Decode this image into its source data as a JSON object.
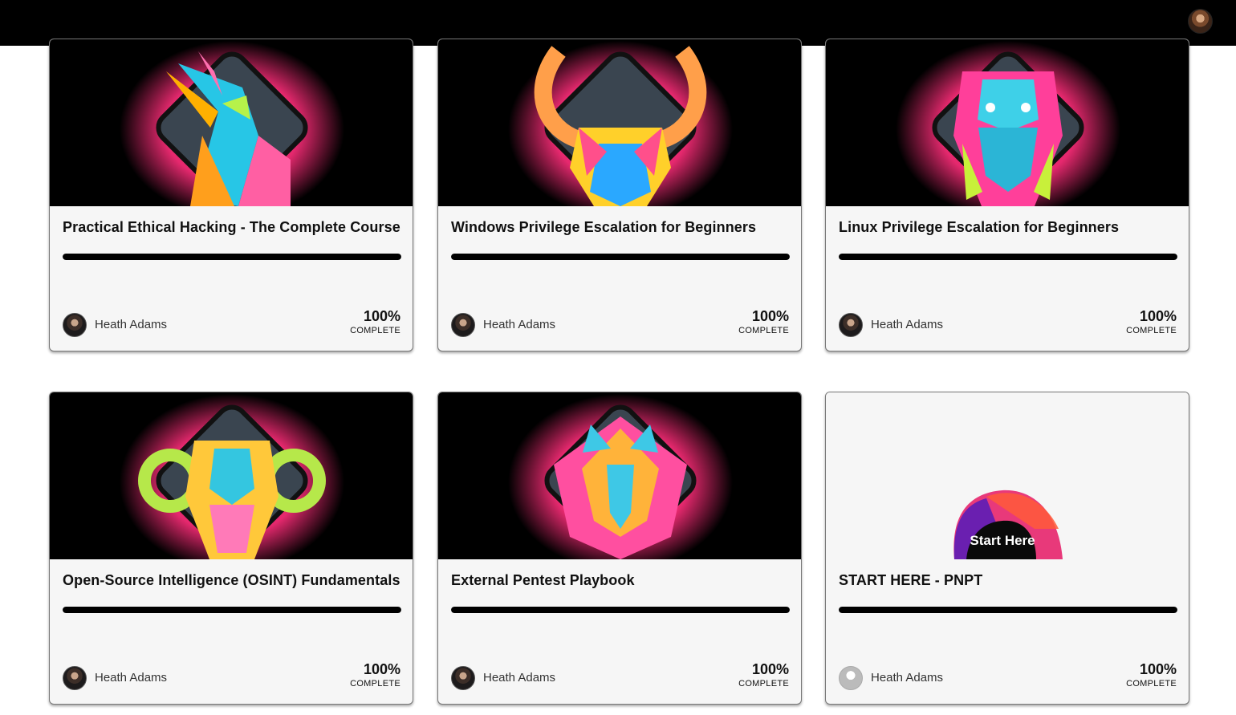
{
  "header": {
    "avatar_icon": "user-avatar-icon"
  },
  "courses": [
    {
      "title": "Practical Ethical Hacking - The Complete Course",
      "instructor": "Heath Adams",
      "progress_percent": 100,
      "progress_label": "100%",
      "complete_label": "COMPLETE",
      "art_icon": "unicorn-mascot-icon",
      "accent": "#ff2d7a"
    },
    {
      "title": "Windows Privilege Escalation for Beginners",
      "instructor": "Heath Adams",
      "progress_percent": 100,
      "progress_label": "100%",
      "complete_label": "COMPLETE",
      "art_icon": "horned-bull-mascot-icon",
      "accent": "#ff2d7a"
    },
    {
      "title": "Linux Privilege Escalation for Beginners",
      "instructor": "Heath Adams",
      "progress_percent": 100,
      "progress_label": "100%",
      "complete_label": "COMPLETE",
      "art_icon": "dragon-mascot-icon",
      "accent": "#ff2d7a"
    },
    {
      "title": "Open-Source Intelligence (OSINT) Fundamentals",
      "instructor": "Heath Adams",
      "progress_percent": 100,
      "progress_label": "100%",
      "complete_label": "COMPLETE",
      "art_icon": "ram-mascot-icon",
      "accent": "#ff2d7a"
    },
    {
      "title": "External Pentest Playbook",
      "instructor": "Heath Adams",
      "progress_percent": 100,
      "progress_label": "100%",
      "complete_label": "COMPLETE",
      "art_icon": "lion-mascot-icon",
      "accent": "#ff2d7a"
    },
    {
      "title": "START HERE - PNPT",
      "instructor": "Heath Adams",
      "progress_percent": 100,
      "progress_label": "100%",
      "complete_label": "COMPLETE",
      "art_icon": "start-here-badge-icon",
      "art_text": "Start Here",
      "accent": "#e8397a"
    }
  ]
}
